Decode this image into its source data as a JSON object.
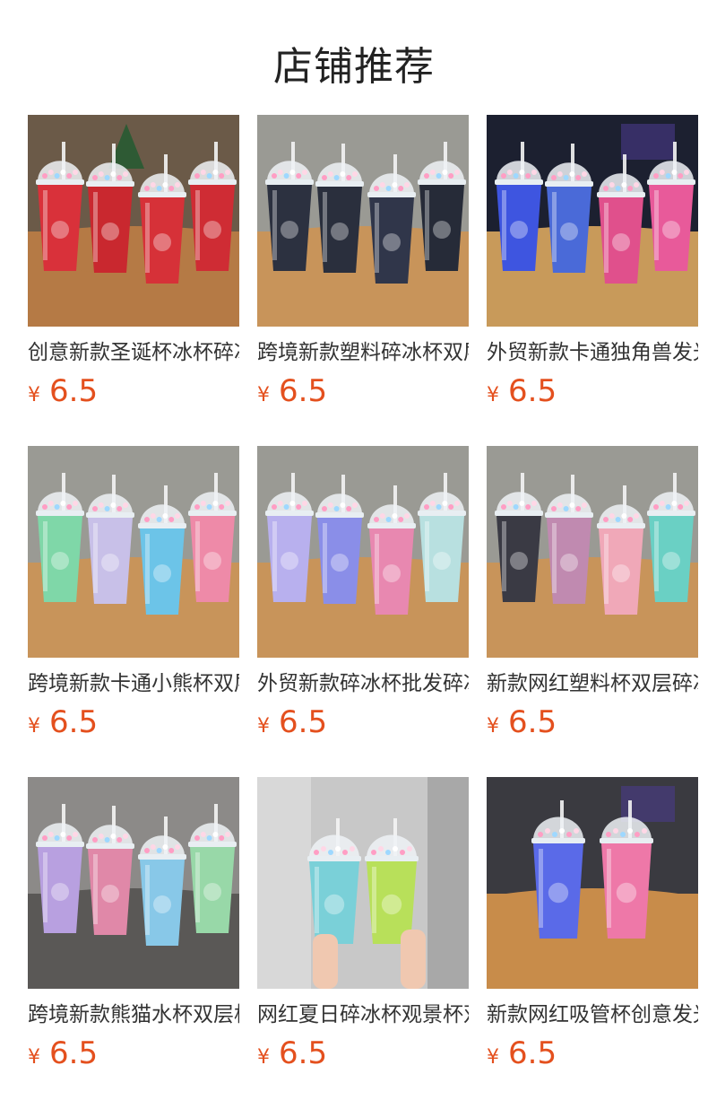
{
  "header": {
    "title": "店铺推荐"
  },
  "colors": {
    "price": "#e4501e",
    "title": "#222222",
    "name": "#333333"
  },
  "products": [
    {
      "name": "创意新款圣诞杯冰杯碎冰杯",
      "currency": "¥",
      "price": "6.5",
      "scene": "christmas",
      "cups": [
        "#d9313a",
        "#c9282f",
        "#d63138",
        "#cf2c34"
      ]
    },
    {
      "name": "跨境新款塑料碎冰杯双层杯",
      "currency": "¥",
      "price": "6.5",
      "scene": "cafe",
      "cups": [
        "#2c3140",
        "#2a2f3d",
        "#30364a",
        "#262b38"
      ]
    },
    {
      "name": "外贸新款卡通独角兽发光杯",
      "currency": "¥",
      "price": "6.5",
      "scene": "night",
      "cups": [
        "#3e55e0",
        "#4a6ad8",
        "#e0508c",
        "#e85a9a"
      ]
    },
    {
      "name": "跨境新款卡通小熊杯双层杯",
      "currency": "¥",
      "price": "6.5",
      "scene": "cafe",
      "cups": [
        "#7fd7a8",
        "#c8c0e8",
        "#6cc4e8",
        "#ee8aa8"
      ]
    },
    {
      "name": "外贸新款碎冰杯批发碎冰杯",
      "currency": "¥",
      "price": "6.5",
      "scene": "cafe",
      "cups": [
        "#b8b0ee",
        "#8a8ee8",
        "#e888b0",
        "#b8e0e0"
      ]
    },
    {
      "name": "新款网红塑料杯双层碎冰杯",
      "currency": "¥",
      "price": "6.5",
      "scene": "cafe",
      "cups": [
        "#3a3a44",
        "#c08ab0",
        "#f0a8b8",
        "#6ad0c4"
      ]
    },
    {
      "name": "跨境新款熊猫水杯双层杯",
      "currency": "¥",
      "price": "6.5",
      "scene": "gray",
      "cups": [
        "#b8a0e0",
        "#e088a8",
        "#88c8e8",
        "#98d8a8"
      ]
    },
    {
      "name": "网红夏日碎冰杯观景杯双层",
      "currency": "¥",
      "price": "6.5",
      "scene": "hands",
      "cups": [
        "#7ad0d8",
        "#b8e05a"
      ]
    },
    {
      "name": "新款网红吸管杯创意发光杯",
      "currency": "¥",
      "price": "6.5",
      "scene": "night2",
      "cups": [
        "#5a6ae8",
        "#ee78a8"
      ]
    }
  ]
}
